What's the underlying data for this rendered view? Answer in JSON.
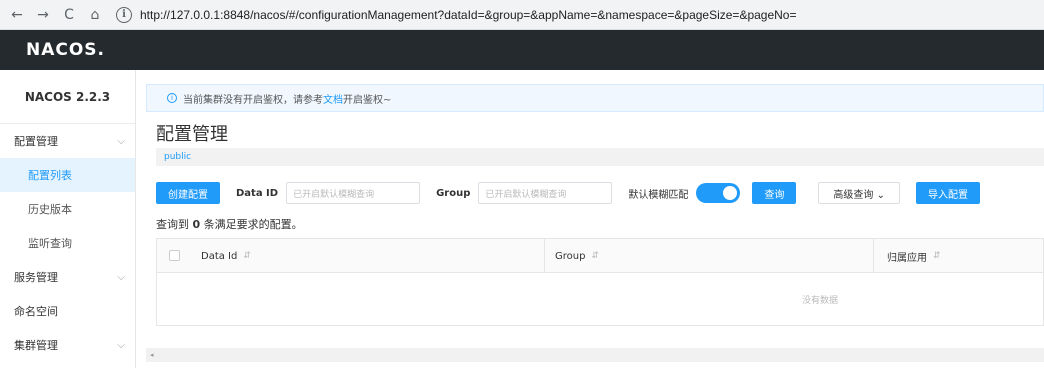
{
  "browser": {
    "back": "←",
    "forward": "→",
    "reload": "C",
    "home": "⌂",
    "info": "i",
    "url": "http://127.0.0.1:8848/nacos/#/configurationManagement?dataId=&group=&appName=&namespace=&pageSize=&pageNo="
  },
  "header": {
    "logo": "NACOS."
  },
  "sidebar": {
    "version": "NACOS 2.2.3",
    "items": [
      {
        "label": "配置管理",
        "chevron": "⌵"
      },
      {
        "label": "配置列表"
      },
      {
        "label": "历史版本"
      },
      {
        "label": "监听查询"
      },
      {
        "label": "服务管理",
        "chevron": "⌵"
      },
      {
        "label": "命名空间"
      },
      {
        "label": "集群管理",
        "chevron": "⌵"
      }
    ]
  },
  "notice": {
    "before": "当前集群没有开启鉴权，请参考",
    "link": "文档",
    "after": "开启鉴权~"
  },
  "page": {
    "title": "配置管理",
    "namespace": "public"
  },
  "filters": {
    "create_label": "创建配置",
    "dataid_label": "Data ID",
    "dataid_placeholder": "已开启默认模糊查询",
    "group_label": "Group",
    "group_placeholder": "已开启默认模糊查询",
    "fuzzy_label": "默认模糊匹配",
    "search_label": "查询",
    "advanced_label": "高级查询 ⌄",
    "import_label": "导入配置"
  },
  "result": {
    "prefix": "查询到 ",
    "count": "0",
    "suffix": " 条满足要求的配置。"
  },
  "table": {
    "columns": [
      "Data Id",
      "Group",
      "归属应用"
    ],
    "sort_icon": "⇵",
    "empty": "没有数据"
  },
  "scroll": {
    "arrow": "◂"
  },
  "colors": {
    "primary": "#209bfa",
    "header_bg": "#252a2f"
  }
}
